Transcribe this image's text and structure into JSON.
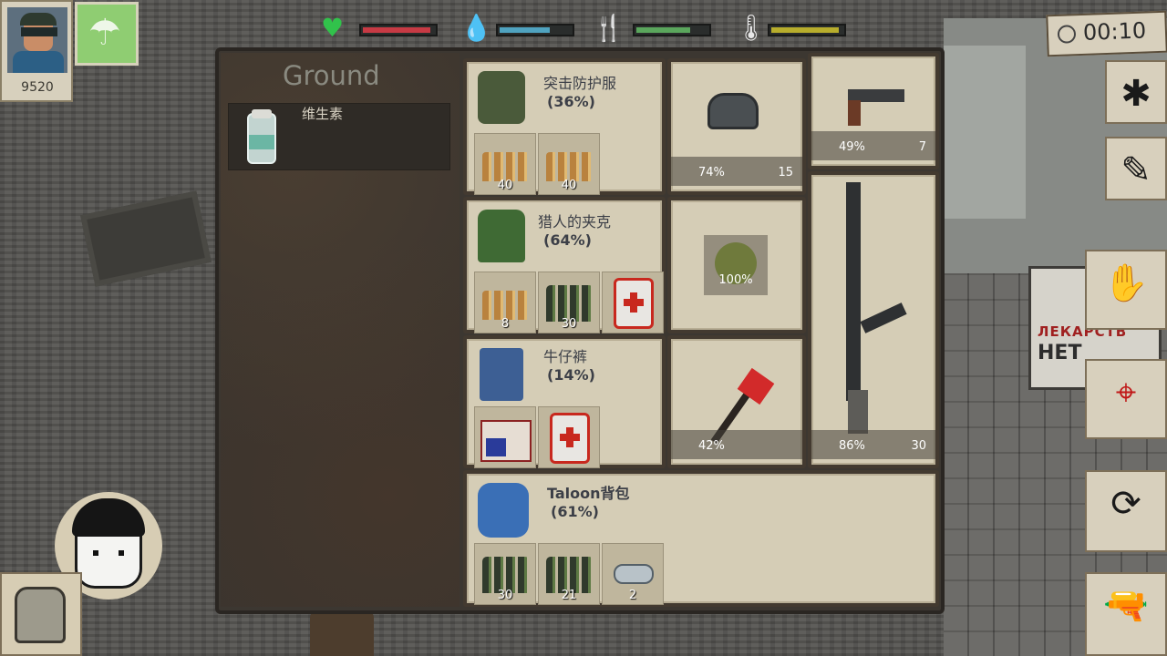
{
  "hud": {
    "money": "9520",
    "timer": "00:10",
    "stats": [
      {
        "name": "health",
        "value": 0.95,
        "color": "#c73a44"
      },
      {
        "name": "water",
        "value": 0.7,
        "color": "#4fa3c0"
      },
      {
        "name": "food",
        "value": 0.75,
        "color": "#5aa65c"
      },
      {
        "name": "temperature",
        "value": 0.95,
        "color": "#b7ad2c"
      }
    ]
  },
  "ground": {
    "title": "Ground",
    "items": [
      {
        "name": "维生素"
      }
    ]
  },
  "equipment": {
    "vest": {
      "name": "突击防护服",
      "condition": "(36%)",
      "slots": [
        "40",
        "40"
      ]
    },
    "jacket": {
      "name": "猎人的夹克",
      "condition": "(64%)",
      "slots": [
        "8",
        "30",
        ""
      ]
    },
    "pants": {
      "name": "牛仔裤",
      "condition": "(14%)",
      "slots": [
        "",
        ""
      ]
    },
    "backpack": {
      "name": "Taloon背包",
      "condition": "(61%)",
      "slots": [
        "30",
        "21",
        "2"
      ]
    },
    "headgear": {
      "durability": "74%",
      "count": "15"
    },
    "canteen": {
      "durability": "100%"
    },
    "axe": {
      "durability": "42%"
    },
    "pistol": {
      "durability": "49%",
      "ammo": "7"
    },
    "rifle": {
      "durability": "86%",
      "ammo": "30"
    }
  },
  "world": {
    "sign_line1": "ЛЕКАРСТВ",
    "sign_line2": "НЕТ"
  }
}
